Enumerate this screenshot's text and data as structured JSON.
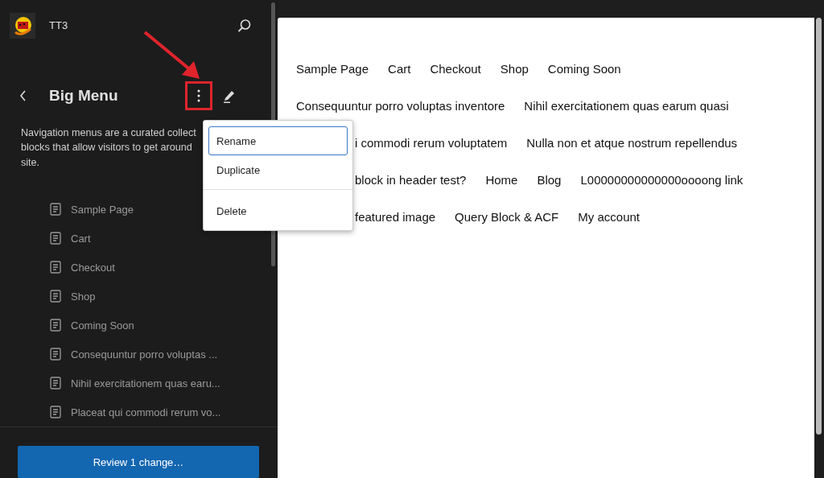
{
  "site": {
    "title": "TT3"
  },
  "menu_panel": {
    "title": "Big Menu",
    "description_lines": [
      "Navigation menus are a curated collect",
      "blocks that allow visitors to get around",
      "site."
    ],
    "items": [
      {
        "label": "Sample Page"
      },
      {
        "label": "Cart"
      },
      {
        "label": "Checkout"
      },
      {
        "label": "Shop"
      },
      {
        "label": "Coming Soon"
      },
      {
        "label": "Consequuntur porro voluptas ..."
      },
      {
        "label": "Nihil exercitationem quas earu..."
      },
      {
        "label": "Placeat qui commodi rerum vo..."
      }
    ]
  },
  "actions_menu": {
    "items": [
      {
        "label": "Rename",
        "selected": true
      },
      {
        "label": "Duplicate",
        "selected": false
      },
      {
        "label": "Delete",
        "selected": false
      }
    ]
  },
  "save_button": "Review 1 change…",
  "preview": {
    "rows": [
      {
        "covered": false,
        "items": [
          "Sample Page",
          "Cart",
          "Checkout",
          "Shop",
          "Coming Soon"
        ]
      },
      {
        "covered": false,
        "items": [
          "Consequuntur porro voluptas inventore",
          "Nihil exercitationem quas earum quasi"
        ]
      },
      {
        "covered": true,
        "items": [
          "i commodi rerum voluptatem",
          "Nulla non et atque nostrum repellendus"
        ]
      },
      {
        "covered": true,
        "items": [
          "block in header test?",
          "Home",
          "Blog",
          "L00000000000000oooong link"
        ]
      },
      {
        "covered": true,
        "items": [
          "featured image",
          "Query Block & ACF",
          "My account"
        ]
      }
    ]
  }
}
